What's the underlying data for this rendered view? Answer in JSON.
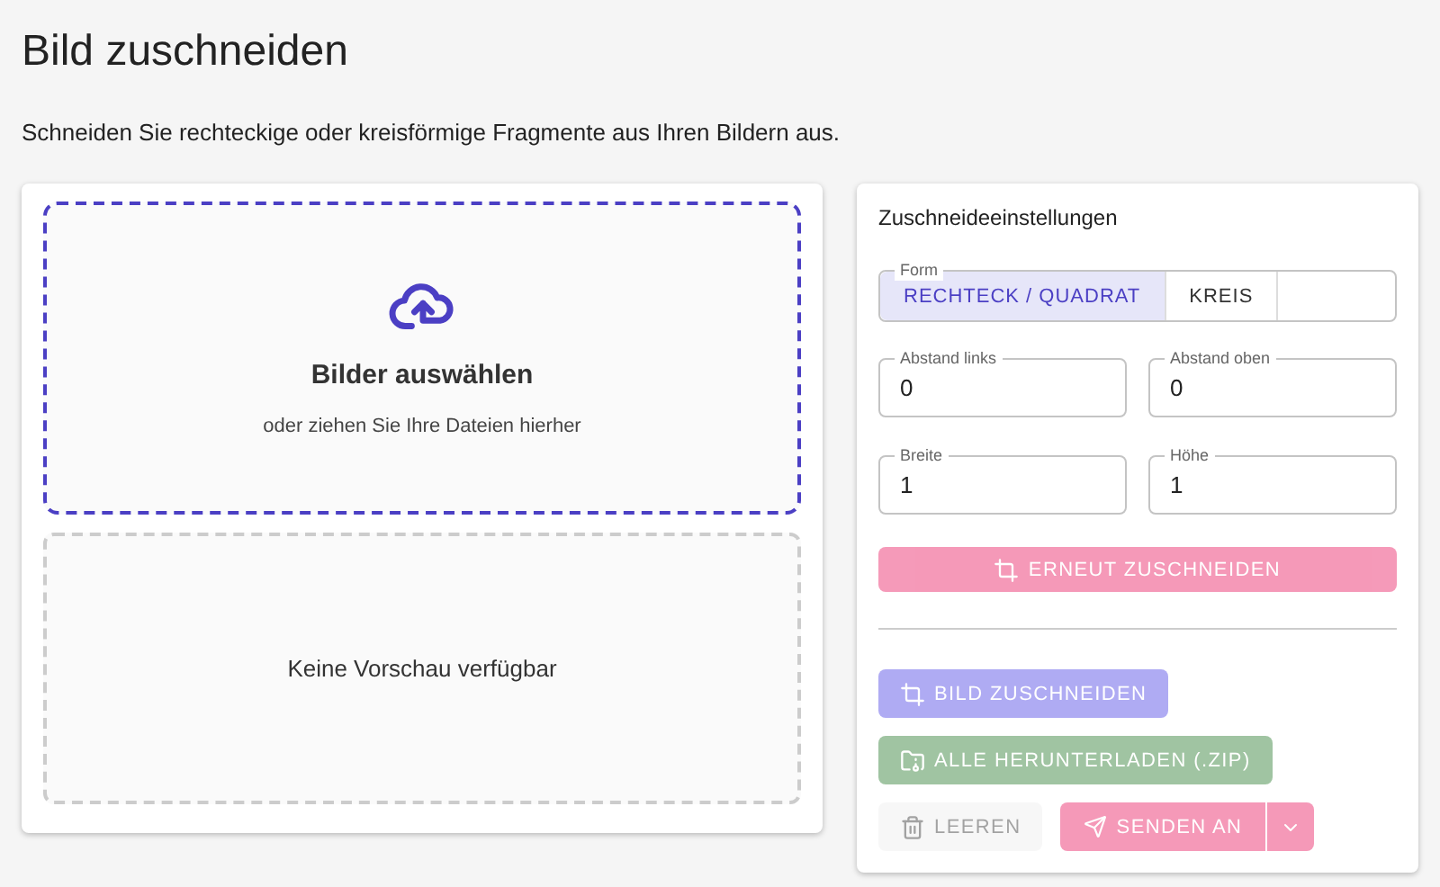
{
  "page": {
    "title": "Bild zuschneiden",
    "subtitle": "Schneiden Sie rechteckige oder kreisförmige Fragmente aus Ihren Bildern aus."
  },
  "dropzone": {
    "title": "Bilder auswählen",
    "hint": "oder ziehen Sie Ihre Dateien hierher"
  },
  "preview": {
    "text": "Keine Vorschau verfügbar"
  },
  "settings": {
    "title": "Zuschneideeinstellungen",
    "shape": {
      "label": "Form",
      "options": [
        {
          "label": "RECHTECK / QUADRAT",
          "selected": true
        },
        {
          "label": "KREIS",
          "selected": false
        }
      ]
    },
    "fields": [
      {
        "label": "Abstand links",
        "value": "0"
      },
      {
        "label": "Abstand oben",
        "value": "0"
      },
      {
        "label": "Breite",
        "value": "1"
      },
      {
        "label": "Höhe",
        "value": "1"
      }
    ],
    "recrop": {
      "label": "ERNEUT ZUSCHNEIDEN",
      "disabled": true
    }
  },
  "actions": {
    "crop": {
      "label": "BILD ZUSCHNEIDEN",
      "disabled": true
    },
    "download": {
      "label": "ALLE HERUNTERLADEN (.ZIP)",
      "disabled": true
    },
    "clear": {
      "label": "LEEREN",
      "disabled": true
    },
    "send": {
      "label": "SENDEN AN",
      "disabled": true
    }
  }
}
